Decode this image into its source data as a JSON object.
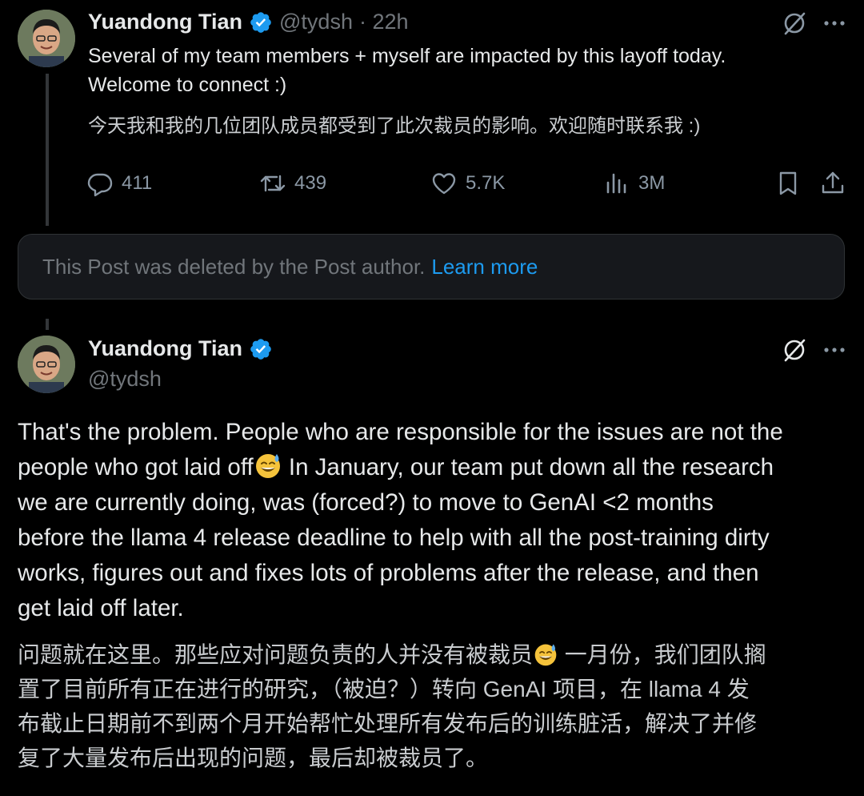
{
  "tweet1": {
    "author_name": "Yuandong Tian",
    "handle": "@tydsh",
    "time": "· 22h",
    "text_en_line1": "Several of my team members + myself are impacted by this layoff today.",
    "text_en_line2": "Welcome to connect :)",
    "text_zh": "今天我和我的几位团队成员都受到了此次裁员的影响。欢迎随时联系我 :)",
    "actions": {
      "replies": "411",
      "reposts": "439",
      "likes": "5.7K",
      "views": "3M"
    }
  },
  "deleted_notice": {
    "text": "This Post was deleted by the Post author.",
    "link": "Learn more"
  },
  "tweet2": {
    "author_name": "Yuandong Tian",
    "handle": "@tydsh",
    "text_en": [
      "That's the problem. People who are responsible for the issues are not the",
      "people who got laid off",
      " In January, our team put down all the research",
      "we are currently doing, was (forced?) to move to GenAI <2 months",
      "before the llama 4 release deadline to help with all the post-training dirty",
      "works, figures out and fixes lots of problems after the release, and then",
      "get laid off later."
    ],
    "text_zh": [
      "问题就在这里。那些应对问题负责的人并没有被裁员",
      " 一月份，我们团队搁",
      "置了目前所有正在进行的研究，（被迫？）转向 GenAI 项目，在 llama 4 发",
      "布截止日期前不到两个月开始帮忙处理所有发布后的训练脏活，解决了并修",
      "复了大量发布后出现的问题，最后却被裁员了。"
    ]
  },
  "icons": [
    "grok-icon",
    "more-icon",
    "reply-icon",
    "repost-icon",
    "like-icon",
    "views-icon",
    "bookmark-icon",
    "share-icon",
    "verified-badge-icon",
    "sweat-smile-emoji"
  ],
  "colors": {
    "background": "#000000",
    "text": "#e7e9ea",
    "secondary": "#71767b",
    "accent": "#1d9bf0"
  }
}
